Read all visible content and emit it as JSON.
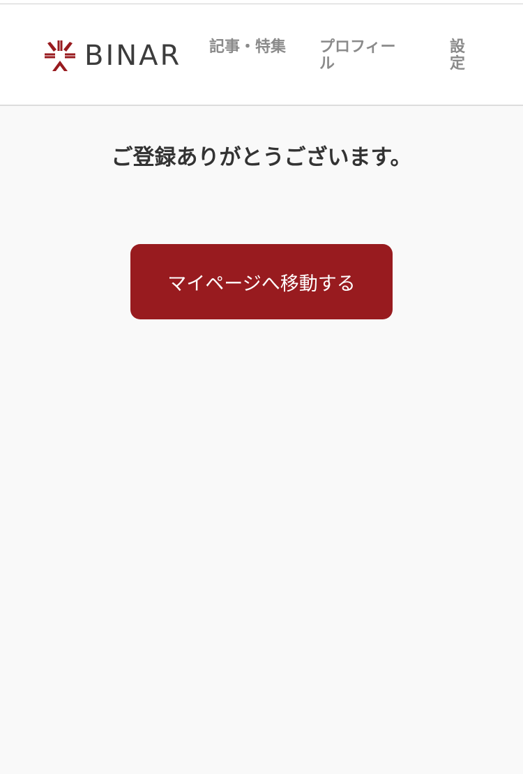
{
  "header": {
    "logo_text": "BINAR",
    "logo_icon": "asterisk-star-logo-icon",
    "nav": {
      "articles_label": "記事・特集",
      "profile_label": "プロフィール",
      "settings_label": "設定"
    }
  },
  "main": {
    "message": "ご登録ありがとうございます。",
    "mypage_button_label": "マイページへ移動する"
  },
  "colors": {
    "brand_red": "#981b1f",
    "nav_text": "#8a8a8a",
    "heading_text": "#333333",
    "page_background": "#f9f9f9"
  }
}
